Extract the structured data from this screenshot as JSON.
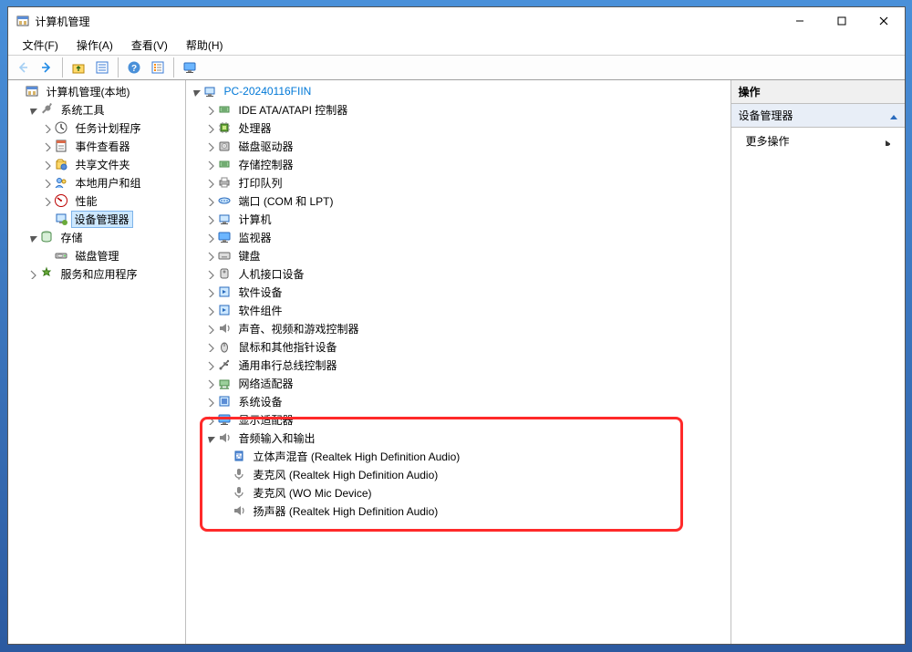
{
  "window": {
    "title": "计算机管理"
  },
  "menu": {
    "file": "文件(F)",
    "action": "操作(A)",
    "view": "查看(V)",
    "help": "帮助(H)"
  },
  "leftTree": {
    "root": "计算机管理(本地)",
    "systemTools": "系统工具",
    "taskScheduler": "任务计划程序",
    "eventViewer": "事件查看器",
    "sharedFolders": "共享文件夹",
    "localUsersGroups": "本地用户和组",
    "performance": "性能",
    "deviceManager": "设备管理器",
    "storage": "存储",
    "diskManagement": "磁盘管理",
    "servicesApps": "服务和应用程序"
  },
  "center": {
    "pcName": "PC-20240116FIIN",
    "ideAtaAtapi": "IDE ATA/ATAPI 控制器",
    "processors": "处理器",
    "diskDrives": "磁盘驱动器",
    "storageControllers": "存储控制器",
    "printQueues": "打印队列",
    "ports": "端口 (COM 和 LPT)",
    "computer": "计算机",
    "monitors": "监视器",
    "keyboards": "键盘",
    "hid": "人机接口设备",
    "softwareDevices": "软件设备",
    "softwareComponents": "软件组件",
    "soundVideoGame": "声音、视频和游戏控制器",
    "miceOtherPointing": "鼠标和其他指针设备",
    "usbControllers": "通用串行总线控制器",
    "networkAdapters": "网络适配器",
    "systemDevices": "系统设备",
    "displayAdapters": "显示适配器",
    "audioInOut": "音频输入和输出",
    "stereoMix": "立体声混音 (Realtek High Definition Audio)",
    "mic1": "麦克风 (Realtek High Definition Audio)",
    "mic2": "麦克风 (WO Mic Device)",
    "speaker": "扬声器 (Realtek High Definition Audio)"
  },
  "right": {
    "header": "操作",
    "section": "设备管理器",
    "moreActions": "更多操作"
  }
}
